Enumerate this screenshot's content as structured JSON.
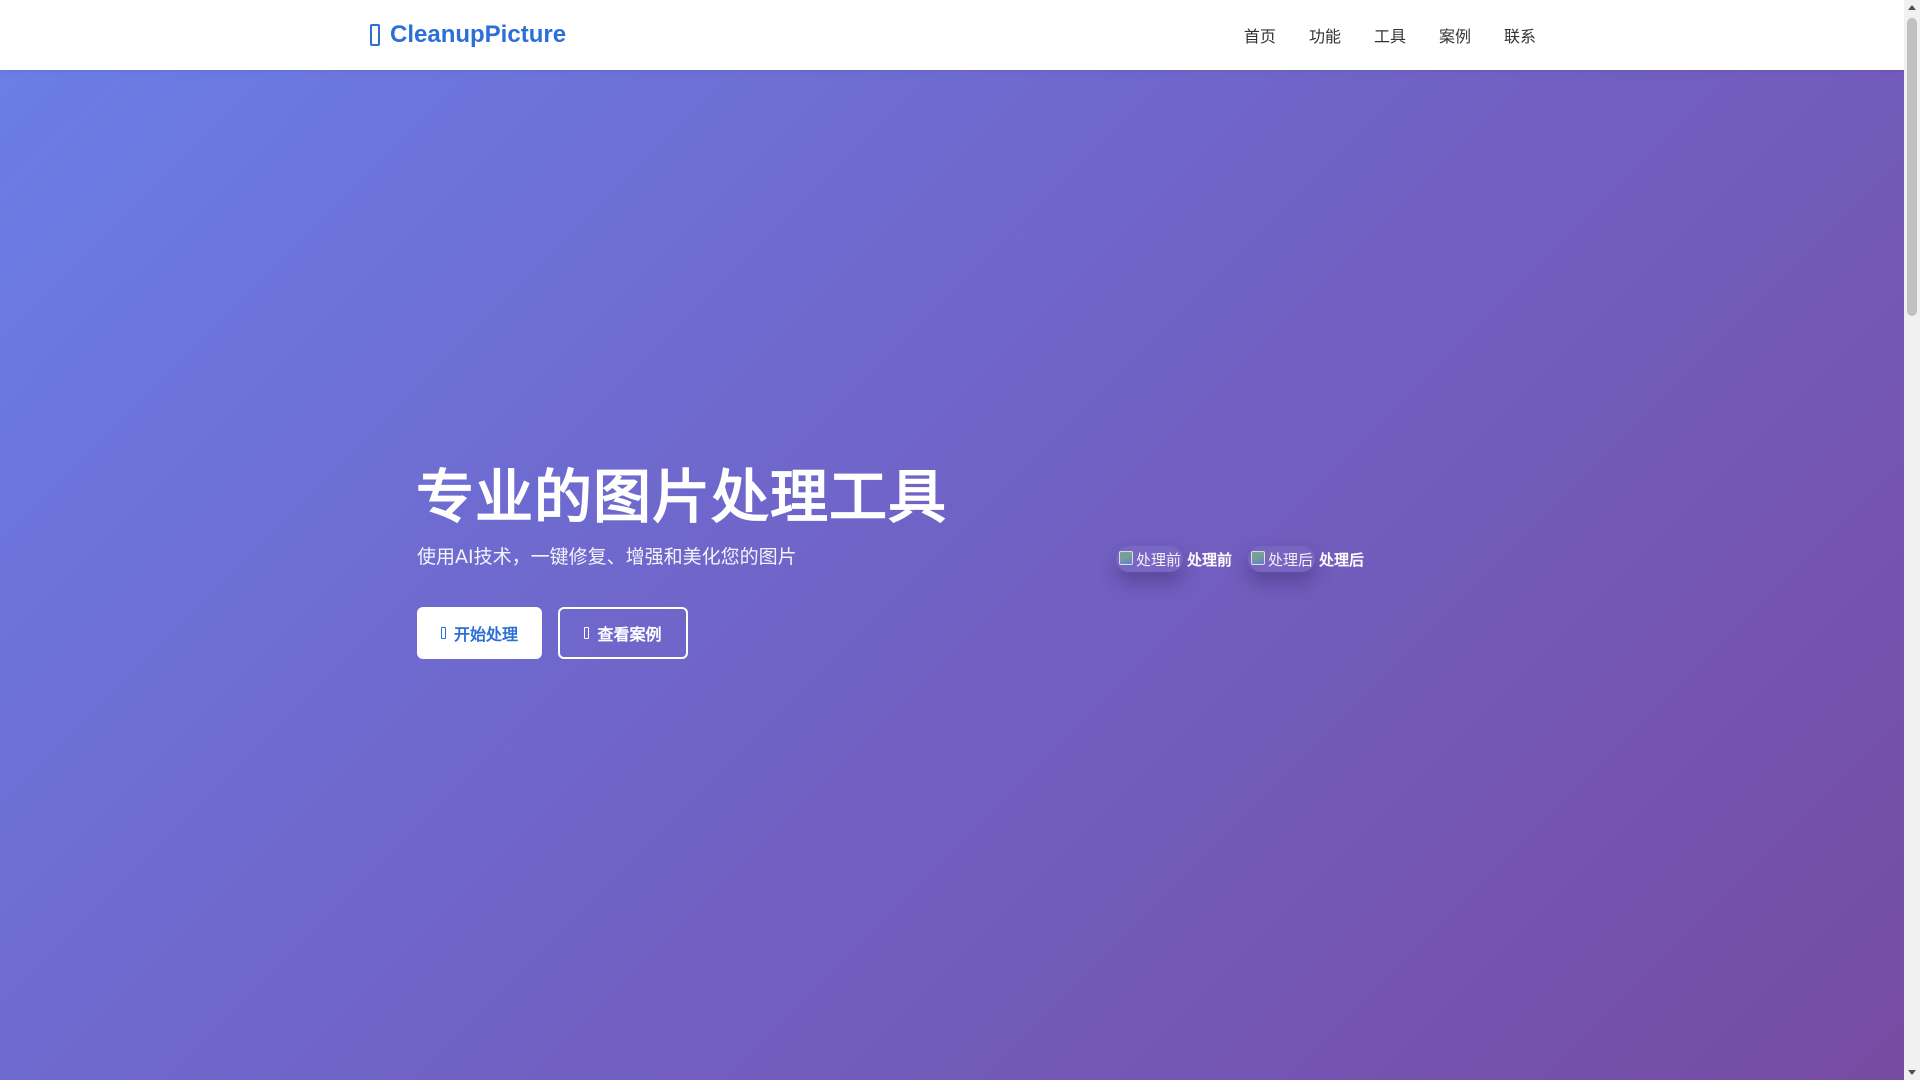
{
  "header": {
    "brand": "CleanupPicture",
    "brand_icon": "brand-icon",
    "nav": [
      {
        "label": "首页"
      },
      {
        "label": "功能"
      },
      {
        "label": "工具"
      },
      {
        "label": "案例"
      },
      {
        "label": "联系"
      }
    ]
  },
  "hero": {
    "title": "专业的图片处理工具",
    "subtitle": "使用AI技术，一键修复、增强和美化您的图片",
    "primary_button": {
      "label": "开始处理",
      "icon": "play-icon"
    },
    "secondary_button": {
      "label": "查看案例",
      "icon": "eye-icon"
    },
    "compare": [
      {
        "alt": "处理前",
        "label": "处理前"
      },
      {
        "alt": "处理后",
        "label": "处理后"
      }
    ]
  },
  "colors": {
    "brand": "#2c6fd6",
    "gradient_start": "#6a7ee6",
    "gradient_end": "#764ba2"
  }
}
